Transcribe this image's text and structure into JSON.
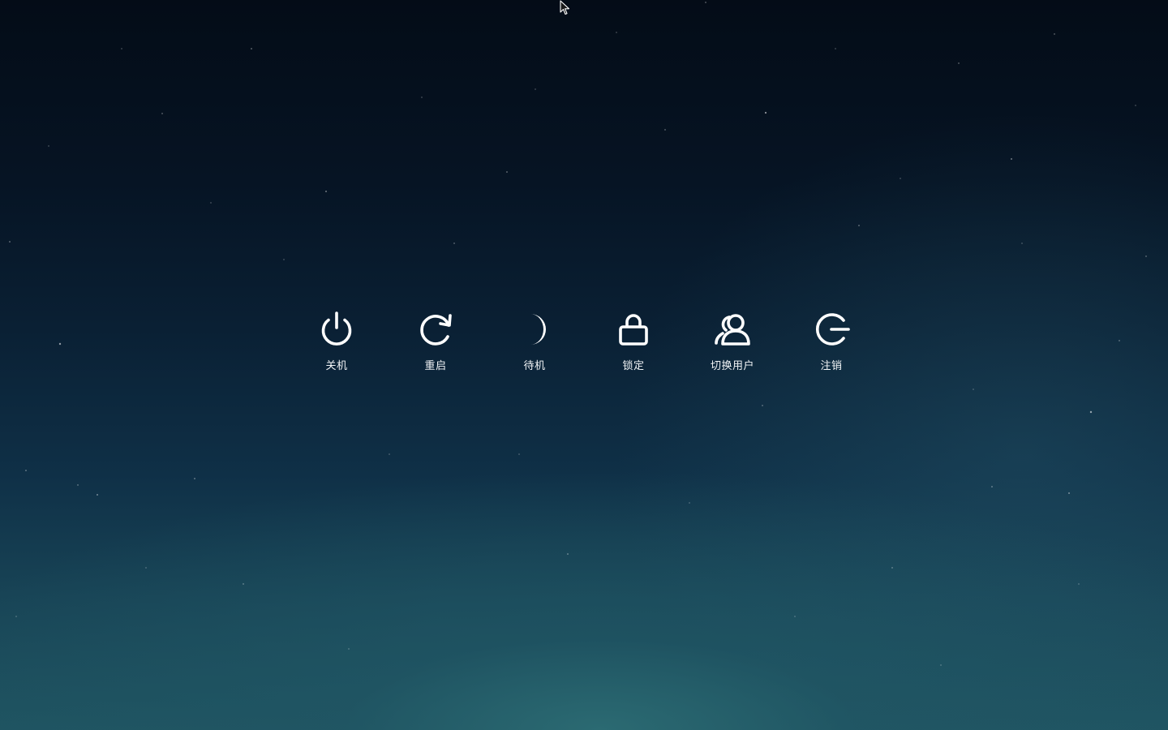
{
  "power_menu": {
    "actions": [
      {
        "label": "关机",
        "icon": "power-icon"
      },
      {
        "label": "重启",
        "icon": "restart-icon"
      },
      {
        "label": "待机",
        "icon": "moon-icon"
      },
      {
        "label": "锁定",
        "icon": "lock-icon"
      },
      {
        "label": "切换用户",
        "icon": "switch-user-icon"
      },
      {
        "label": "注销",
        "icon": "logout-icon"
      }
    ]
  },
  "colors": {
    "icon": "#ffffff",
    "label": "#f2f5f7",
    "background_top": "#040c17",
    "background_bottom": "#2b6a72"
  }
}
